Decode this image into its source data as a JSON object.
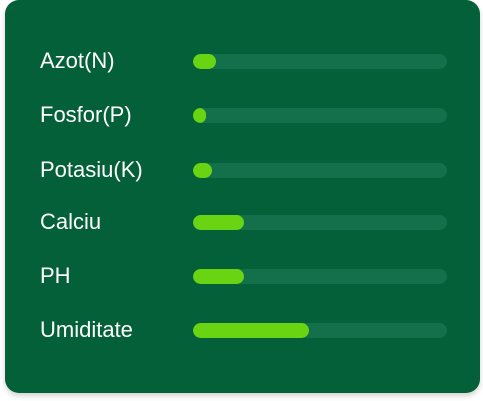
{
  "colors": {
    "card_background": "#046038",
    "track": "#13704a",
    "fill": "#69d412",
    "text": "#ffffff"
  },
  "nutrients": [
    {
      "label": "Azot(N)",
      "level": 0.09
    },
    {
      "label": "Fosfor(P)",
      "level": 0.05
    },
    {
      "label": "Potasiu(K)",
      "level": 0.075
    },
    {
      "label": "Calciu",
      "level": 0.2
    },
    {
      "label": "PH",
      "level": 0.2
    },
    {
      "label": "Umiditate",
      "level": 0.455
    }
  ]
}
